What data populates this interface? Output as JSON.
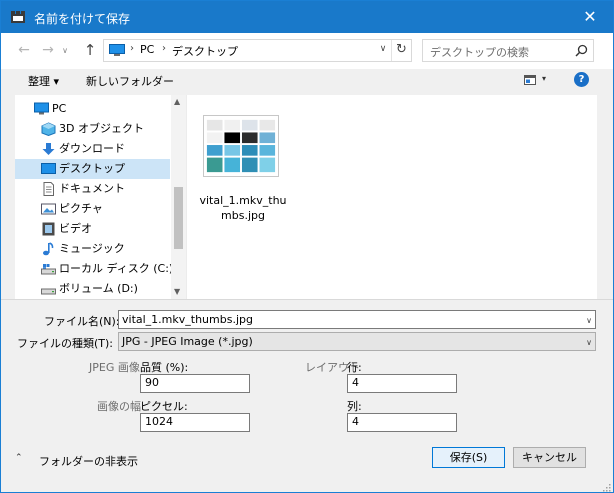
{
  "titlebar": {
    "title": "名前を付けて保存",
    "close_glyph": "✕"
  },
  "nav": {
    "back_glyph": "←",
    "forward_glyph": "→",
    "recent_glyph": "∨",
    "up_glyph": "↑",
    "breadcrumb": [
      "PC",
      "デスクトップ"
    ],
    "crumb_sep": "›",
    "dropdown_glyph": "∨",
    "refresh_glyph": "↻",
    "search_placeholder": "デスクトップの検索"
  },
  "toolbar": {
    "organize_label": "整理 ▾",
    "new_folder_label": "新しいフォルダー",
    "view_arrow_glyph": "▾",
    "help_label": "?"
  },
  "tree": {
    "items": [
      {
        "label": "PC",
        "icon": "computer-icon",
        "level": 0
      },
      {
        "label": "3D オブジェクト",
        "icon": "3d-objects-icon",
        "level": 1
      },
      {
        "label": "ダウンロード",
        "icon": "download-icon",
        "level": 1
      },
      {
        "label": "デスクトップ",
        "icon": "desktop-icon",
        "level": 1,
        "selected": true
      },
      {
        "label": "ドキュメント",
        "icon": "document-icon",
        "level": 1
      },
      {
        "label": "ピクチャ",
        "icon": "pictures-icon",
        "level": 1
      },
      {
        "label": "ビデオ",
        "icon": "video-icon",
        "level": 1
      },
      {
        "label": "ミュージック",
        "icon": "music-icon",
        "level": 1
      },
      {
        "label": "ローカル ディスク (C:)",
        "icon": "local-disk-icon",
        "level": 1
      },
      {
        "label": "ボリューム (D:)",
        "icon": "volume-drive-icon",
        "level": 1
      }
    ],
    "scroll_up_glyph": "▲",
    "scroll_down_glyph": "▼"
  },
  "files": [
    {
      "name": "vital_1.mkv_thumbs.jpg",
      "icon": "image-thumbnail"
    }
  ],
  "form": {
    "filename_label": "ファイル名(N):",
    "filename_value": "vital_1.mkv_thumbs.jpg",
    "filetype_label": "ファイルの種類(T):",
    "filetype_value": "JPG - JPEG Image (*.jpg)",
    "field_arrow_glyph": "∨",
    "jpeg_group_label": "JPEG 画像",
    "quality_label": "品質 (%):",
    "quality_value": "90",
    "width_group_label": "画像の幅",
    "pixels_label": "ピクセル:",
    "pixels_value": "1024",
    "layout_group_label": "レイアウト",
    "rows_label": "行:",
    "rows_value": "4",
    "cols_label": "列:",
    "cols_value": "4"
  },
  "footer": {
    "toggle_glyph": "⌃",
    "hide_folders_label": "フォルダーの非表示",
    "save_label": "保存(S)",
    "cancel_label": "キャンセル"
  },
  "colors": {
    "titlebar": "#1979ca",
    "selection": "#cce4f7",
    "accent": "#0078d7"
  }
}
